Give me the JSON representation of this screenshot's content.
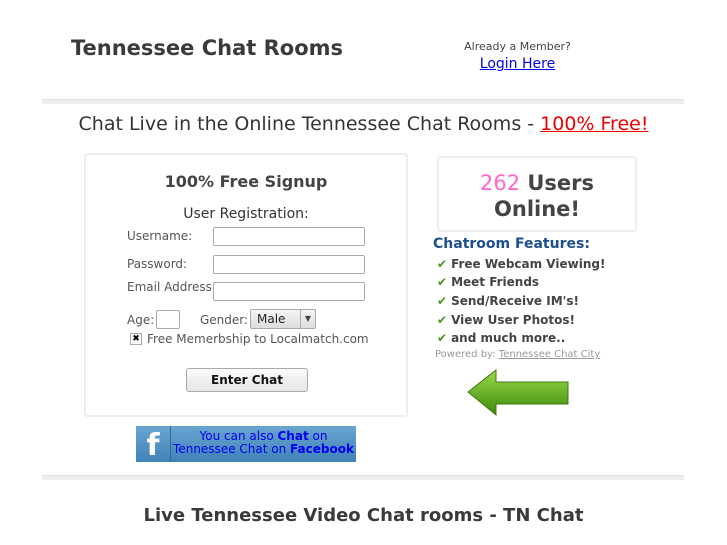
{
  "header": {
    "title": "Tennessee Chat Rooms",
    "member_prompt": "Already a Member?",
    "login_label": "Login Here"
  },
  "headline": {
    "text": "Chat Live in the Online Tennessee Chat Rooms - ",
    "highlight": "100% Free!"
  },
  "signup": {
    "title": "100% Free Signup",
    "subtitle": "User Registration:",
    "username_label": "Username:",
    "password_label": "Password:",
    "email_label": "Email Address:",
    "age_label": "Age:",
    "gender_label": "Gender:",
    "gender_value": "Male",
    "checkbox_label": "Free Memerbship to Localmatch.com",
    "submit_label": "Enter Chat"
  },
  "facebook": {
    "line1a": "You can also ",
    "line1b": "Chat",
    "line1c": " on",
    "line2a": "Tennessee Chat on ",
    "line2b": "Facebook"
  },
  "users": {
    "count": "262",
    "label1": "Users",
    "label2": "Online!"
  },
  "features": {
    "title": "Chatroom Features:",
    "items": [
      "Free Webcam Viewing!",
      "Meet Friends",
      "Send/Receive IM's!",
      "View User Photos!",
      "and much more.."
    ],
    "powered_label": "Powered by:",
    "powered_link": "Tennessee Chat City"
  },
  "footer": {
    "heading": "Live Tennessee Video Chat rooms - TN Chat"
  },
  "colors": {
    "accent_red": "#ee0000",
    "count_pink": "#ff66cc",
    "feature_blue": "#1d4f8c",
    "check_green": "#3a9a1a"
  }
}
